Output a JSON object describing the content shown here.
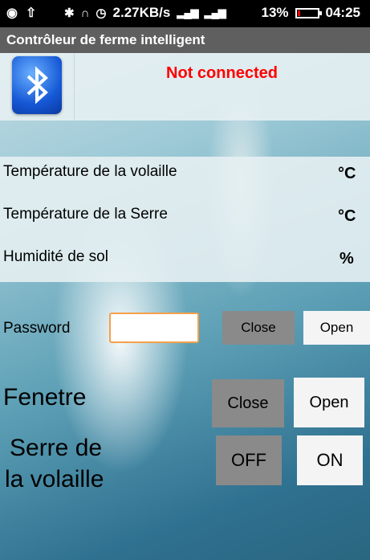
{
  "status_bar": {
    "icons_left": [
      "spotify-icon",
      "upload-icon"
    ],
    "net_speed": "2.27KB/s",
    "battery_percent": "13%",
    "time": "04:25"
  },
  "app": {
    "title": "Contrôleur de ferme intelligent"
  },
  "bluetooth": {
    "status": "Not connected",
    "status_color": "#ff0000"
  },
  "sensors": [
    {
      "label": "Température de la volaille",
      "unit": "°C"
    },
    {
      "label": "Température de la Serre",
      "unit": "°C"
    },
    {
      "label": "Humidité de sol",
      "unit": "%"
    }
  ],
  "password": {
    "label": "Password",
    "value": "",
    "close_label": "Close",
    "open_label": "Open"
  },
  "fenetre": {
    "label": "Fenetre",
    "close_label": "Close",
    "open_label": "Open"
  },
  "serre": {
    "label_line1": "Serre de",
    "label_line2": "la volaille",
    "off_label": "OFF",
    "on_label": "ON"
  }
}
